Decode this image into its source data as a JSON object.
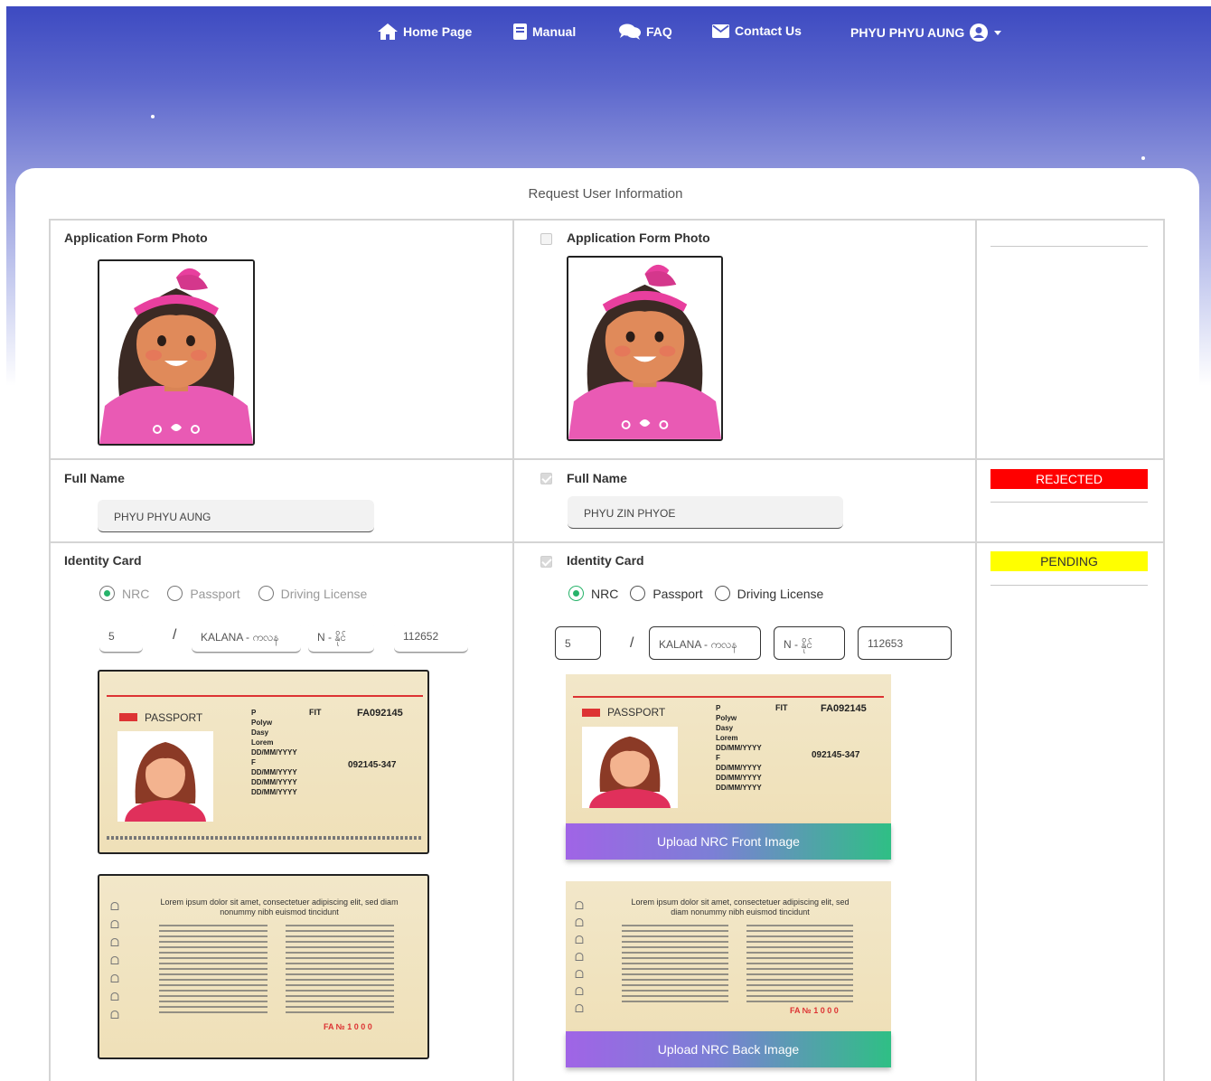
{
  "nav": {
    "home": "Home Page",
    "manual": "Manual",
    "faq": "FAQ",
    "contact": "Contact Us",
    "user": "PHYU PHYU AUNG"
  },
  "page_title": "Request User Information",
  "left": {
    "photo_label": "Application Form Photo",
    "name_label": "Full Name",
    "name_value": "PHYU PHYU AUNG",
    "id_label": "Identity Card",
    "id_types": [
      "NRC",
      "Passport",
      "Driving License"
    ],
    "nrc": {
      "state": "5",
      "township": "KALANA - ကလန",
      "type": "N - နိုင်",
      "number": "112652"
    }
  },
  "right": {
    "photo_label": "Application Form Photo",
    "name_label": "Full Name",
    "name_value": "PHYU ZIN PHYOE",
    "id_label": "Identity Card",
    "id_types": [
      "NRC",
      "Passport",
      "Driving License"
    ],
    "nrc": {
      "state": "5",
      "township": "KALANA - ကလန",
      "type": "N - နိုင်",
      "number": "112653"
    },
    "upload_front": "Upload NRC Front Image",
    "upload_back": "Upload NRC Back Image"
  },
  "status": {
    "name": "REJECTED",
    "identity": "PENDING"
  },
  "passport": {
    "title": "PASSPORT",
    "type_value": "P",
    "country": "FIT",
    "number": "FA092145",
    "surname": "Polyw",
    "given": "Dasy",
    "nationality": "Lorem",
    "dob": "DD/MM/YYYY",
    "sex": "F",
    "place": "DD/MM/YYYY",
    "issue": "DD/MM/YYYY",
    "expiry": "DD/MM/YYYY",
    "personal_no": "092145-347",
    "back_heading": "Lorem ipsum dolor sit amet, consectetuer adipiscing elit, sed diam nonummy nibh euismod tincidunt",
    "back_stamp": "FA № 1 0 0 0"
  },
  "colors": {
    "rejected": "#ff0000",
    "pending": "#ffff00",
    "radio_active": "#27b36a"
  }
}
